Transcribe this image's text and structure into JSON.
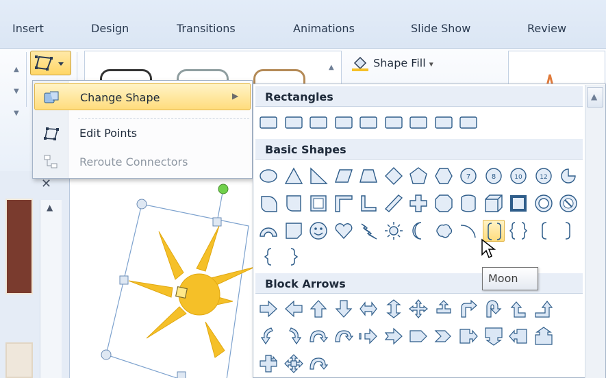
{
  "ribbon": {
    "tabs": [
      "Insert",
      "Design",
      "Transitions",
      "Animations",
      "Slide Show",
      "Review"
    ],
    "shape_fill_label": "Shape Fill",
    "shape_fill_arrow": "▾"
  },
  "context_menu": {
    "items": [
      {
        "label": "Change Shape",
        "icon": "change-shape-icon",
        "submenu_arrow": "▶"
      },
      {
        "label": "Edit Points",
        "icon": "edit-points-icon"
      },
      {
        "label": "Reroute Connectors",
        "icon": "reroute-connectors-icon",
        "disabled": true
      }
    ]
  },
  "shapes_menu": {
    "sections": [
      {
        "title": "Rectangles",
        "count": 9
      },
      {
        "title": "Basic Shapes",
        "count": 42
      },
      {
        "title": "Block Arrows",
        "count": 27
      }
    ],
    "hovered_shape": "Moon",
    "number_badges": [
      "7",
      "8",
      "10",
      "12"
    ]
  },
  "tooltip": {
    "text": "Moon"
  },
  "colors": {
    "accent_hover": "#ffdc7c",
    "shape_outline": "#2f5d8a",
    "sun_fill": "#f5c028",
    "selection": "#7da2ce",
    "rotation_handle": "#6fd04b"
  }
}
